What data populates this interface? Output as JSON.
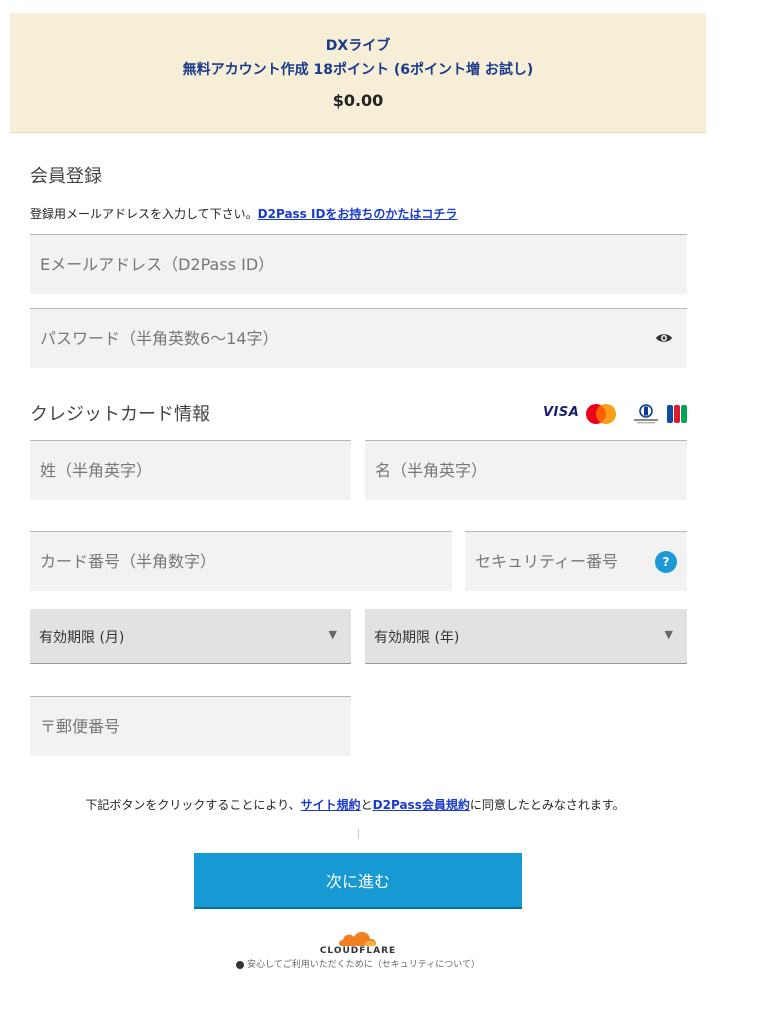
{
  "banner": {
    "title": "DXライブ",
    "subtitle": "無料アカウント作成 18ポイント (6ポイント増 お試し)",
    "price": "$0.00"
  },
  "registration": {
    "title": "会員登録",
    "hint_text": "登録用メールアドレスを入力して下さい。",
    "hint_link": "D2Pass IDをお持ちのかたはコチラ",
    "email_placeholder": "Eメールアドレス（D2Pass ID）",
    "password_placeholder": "パスワード（半角英数6〜14字）"
  },
  "credit_card": {
    "title": "クレジットカード情報",
    "brand_visa": "VISA",
    "last_name_placeholder": "姓（半角英字）",
    "first_name_placeholder": "名（半角英字）",
    "card_number_placeholder": "カード番号（半角数字）",
    "security_code_placeholder": "セキュリティー番号",
    "security_help": "?",
    "expiry_month": "有効期限 (月)",
    "expiry_year": "有効期限 (年)",
    "postal_code_placeholder": "〒郵便番号",
    "icons": [
      "visa-icon",
      "mastercard-icon",
      "diners-club-icon",
      "jcb-icon"
    ]
  },
  "agreement": {
    "prefix": "下記ボタンをクリックすることにより、",
    "link1": "サイト規約",
    "middle": "と",
    "link2": "D2Pass会員規約",
    "suffix": "に同意したとみなされます。"
  },
  "submit_label": "次に進む",
  "cloudflare": {
    "brand": "CLOUDFLARE",
    "note": "安心してご利用いただくために（セキュリティについて）"
  },
  "colors": {
    "banner_bg": "#f6eed6",
    "accent": "#179ad3",
    "link": "#1a3acc"
  }
}
